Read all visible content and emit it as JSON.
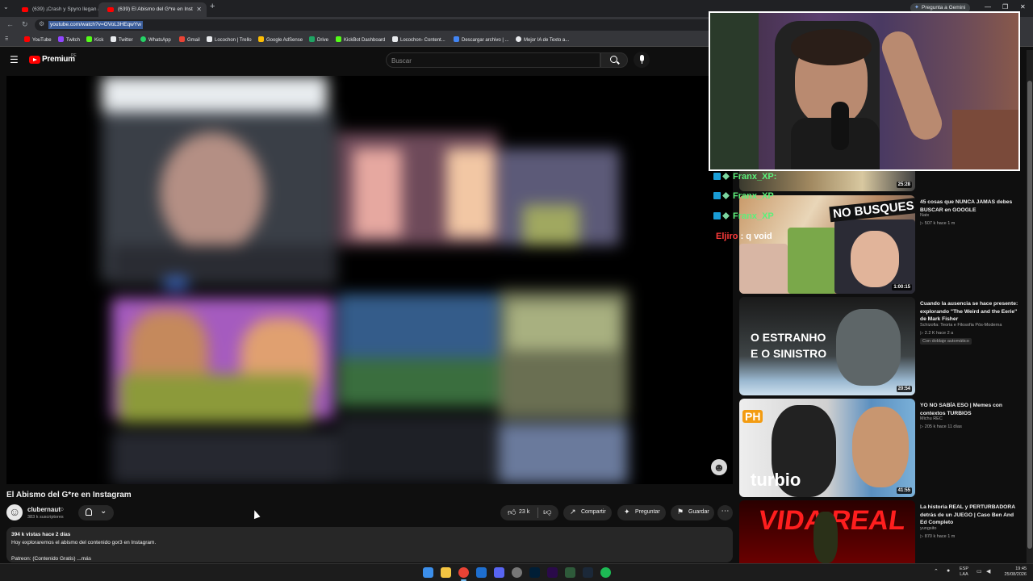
{
  "browser": {
    "tabs": [
      {
        "title": "(639) ¡Crash y Spyro llegan a Fo",
        "active": false
      },
      {
        "title": "(639) El Abismo del G*re en Inst",
        "active": true
      }
    ],
    "gemini_label": "Pregunta a Gemini",
    "url": "youtube.com/watch?v=OVoL3HEqwYw",
    "bookmarks": [
      "YouTube",
      "Twitch",
      "Kick",
      "Twitter",
      "WhatsApp",
      "Gmail",
      "Locochon | Trello",
      "Google AdSense",
      "Drive",
      "KickBot Dashboard",
      "Locochon- Content...",
      "Descargar archivo | ...",
      "Mejor IA de Texto a..."
    ]
  },
  "yt": {
    "brand": "Premium",
    "region": "PE",
    "search_placeholder": "Buscar"
  },
  "video": {
    "title": "El Abismo del G*re en Instagram",
    "channel": "clubernaut",
    "verified": "⊙",
    "subscribers": "383 k suscriptores",
    "likes": "23 k",
    "share_label": "Compartir",
    "ask_label": "Preguntar",
    "save_label": "Guardar",
    "views_date": "394 k vistas  hace 2 días",
    "description": "Hoy exploraremos el abismo del contenido gor3 en Instagram.",
    "description_more": "Patreon: (Contenido Gratis)  ...más"
  },
  "chat": [
    {
      "user": "Franx_XP",
      "message": ":"
    },
    {
      "user": "Franx_XP",
      "message": ""
    },
    {
      "user": "Franx_XP",
      "message": ""
    },
    {
      "user": "Eljiro",
      "message": " : q void"
    }
  ],
  "recommendations": [
    {
      "duration": "25:28",
      "title": "",
      "channel": "",
      "meta": ""
    },
    {
      "duration": "1:00:15",
      "title": "45 cosas que NUNCA JAMAS debes BUSCAR en GOOGLE",
      "channel": "Natx",
      "meta": "▷ 507 k  hace 1 m",
      "thumb_text": "NO BUSQUES..."
    },
    {
      "duration": "20:54",
      "title": "Cuando la ausencia se hace presente: explorando \"The Weird and the Eerie\" de Mark Fisher",
      "channel": "Schizofia: Teoria e Filosofia Pós-Moderna",
      "meta": "▷ 2.2 K  hace 2 a",
      "badge": "Con doblaje automático",
      "thumb_text_1": "O ESTRANHO",
      "thumb_text_2": "E O SINISTRO"
    },
    {
      "duration": "41:55",
      "title": "YO NO SABÍA ESO | Memes con contextos TURBIOS",
      "channel": "Michu REC",
      "meta": "▷ 205 k  hace 11 días",
      "thumb_text": "turbio",
      "thumb_badge": "PH"
    },
    {
      "duration": "",
      "title": "La historia REAL y PERTURBADORA detrás de un JUEGO | Caso Ben And Ed Completo",
      "channel": "yungsito",
      "meta": "▷ 870 k  hace 1 m",
      "thumb_text": "VIDA REAL"
    }
  ],
  "taskbar": {
    "lang_1": "ESP",
    "lang_2": "LAA",
    "time": "19:45",
    "date": "25/08/2026"
  }
}
